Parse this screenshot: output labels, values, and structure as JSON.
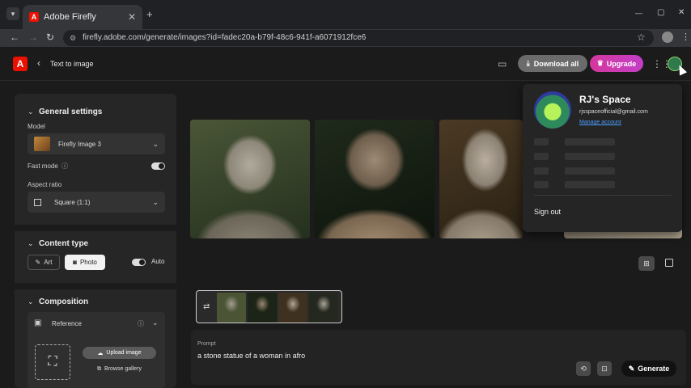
{
  "browser": {
    "tab_title": "Adobe Firefly",
    "tab_close": "✕",
    "new_tab": "+",
    "url": "firefly.adobe.com/generate/images?id=fadec20a-b79f-48c6-941f-a6071912fce6",
    "window_controls": [
      "—",
      "▢",
      "✕"
    ]
  },
  "header": {
    "logo": "A",
    "back_arrow": "‹",
    "title": "Text to image",
    "download_label": "Download all",
    "upgrade_label": "Upgrade"
  },
  "left_panel": {
    "general_settings_title": "General settings",
    "model_label": "Model",
    "model_value": "Firefly Image 3",
    "fast_mode_label": "Fast mode",
    "aspect_ratio_label": "Aspect ratio",
    "aspect_ratio_value": "Square (1:1)",
    "content_type_title": "Content type",
    "art_label": "Art",
    "photo_label": "Photo",
    "auto_label": "Auto",
    "composition_title": "Composition",
    "reference_label": "Reference",
    "upload_label": "Upload image",
    "browse_label": "Browse gallery"
  },
  "main": {
    "prompt_label": "Prompt",
    "prompt_text": "a stone statue of a woman in afro",
    "generate_label": "Generate"
  },
  "account_popup": {
    "name": "RJ's Space",
    "email": "rjsspaceofficial@gmail.com",
    "manage_label": "Manage account",
    "sign_out_label": "Sign out"
  },
  "colors": {
    "accent_red": "#eb1000",
    "upgrade_gradient_start": "#d4379d",
    "upgrade_gradient_end": "#c33fc6",
    "link_blue": "#4a9eff"
  }
}
